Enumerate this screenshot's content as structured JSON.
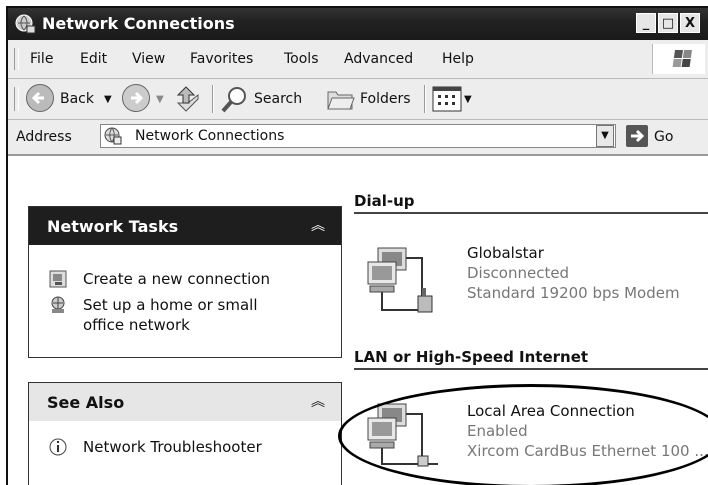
{
  "window": {
    "title": "Network Connections",
    "controls": [
      "_",
      "□",
      "X"
    ]
  },
  "menu": [
    "File",
    "Edit",
    "View",
    "Favorites",
    "Tools",
    "Advanced",
    "Help"
  ],
  "toolbar": {
    "back_label": "Back",
    "search_label": "Search",
    "folders_label": "Folders"
  },
  "address": {
    "label": "Address",
    "value": "Network Connections",
    "go_label": "Go"
  },
  "tasks_panel": {
    "title": "Network Tasks",
    "items": [
      {
        "label": "Create a new connection"
      },
      {
        "label_line1": "Set up a home or small",
        "label_line2": "office network"
      }
    ]
  },
  "see_also_panel": {
    "title": "See Also",
    "items": [
      {
        "label": "Network Troubleshooter"
      }
    ]
  },
  "groups": {
    "dialup": {
      "header": "Dial-up",
      "connection": {
        "name": "Globalstar",
        "status": "Disconnected",
        "device": "Standard 19200 bps Modem"
      }
    },
    "lan": {
      "header": "LAN or High-Speed Internet",
      "connection": {
        "name": "Local Area Connection",
        "status": "Enabled",
        "device": "Xircom CardBus Ethernet 100 ..."
      }
    }
  },
  "icons": {
    "window": "network-connections-icon",
    "back": "back-arrow-icon",
    "forward": "forward-arrow-icon",
    "up": "up-folder-icon",
    "search": "search-icon",
    "folders": "folders-icon",
    "views": "views-icon",
    "go": "go-arrow-icon",
    "collapse": "chevron-up-icon"
  }
}
